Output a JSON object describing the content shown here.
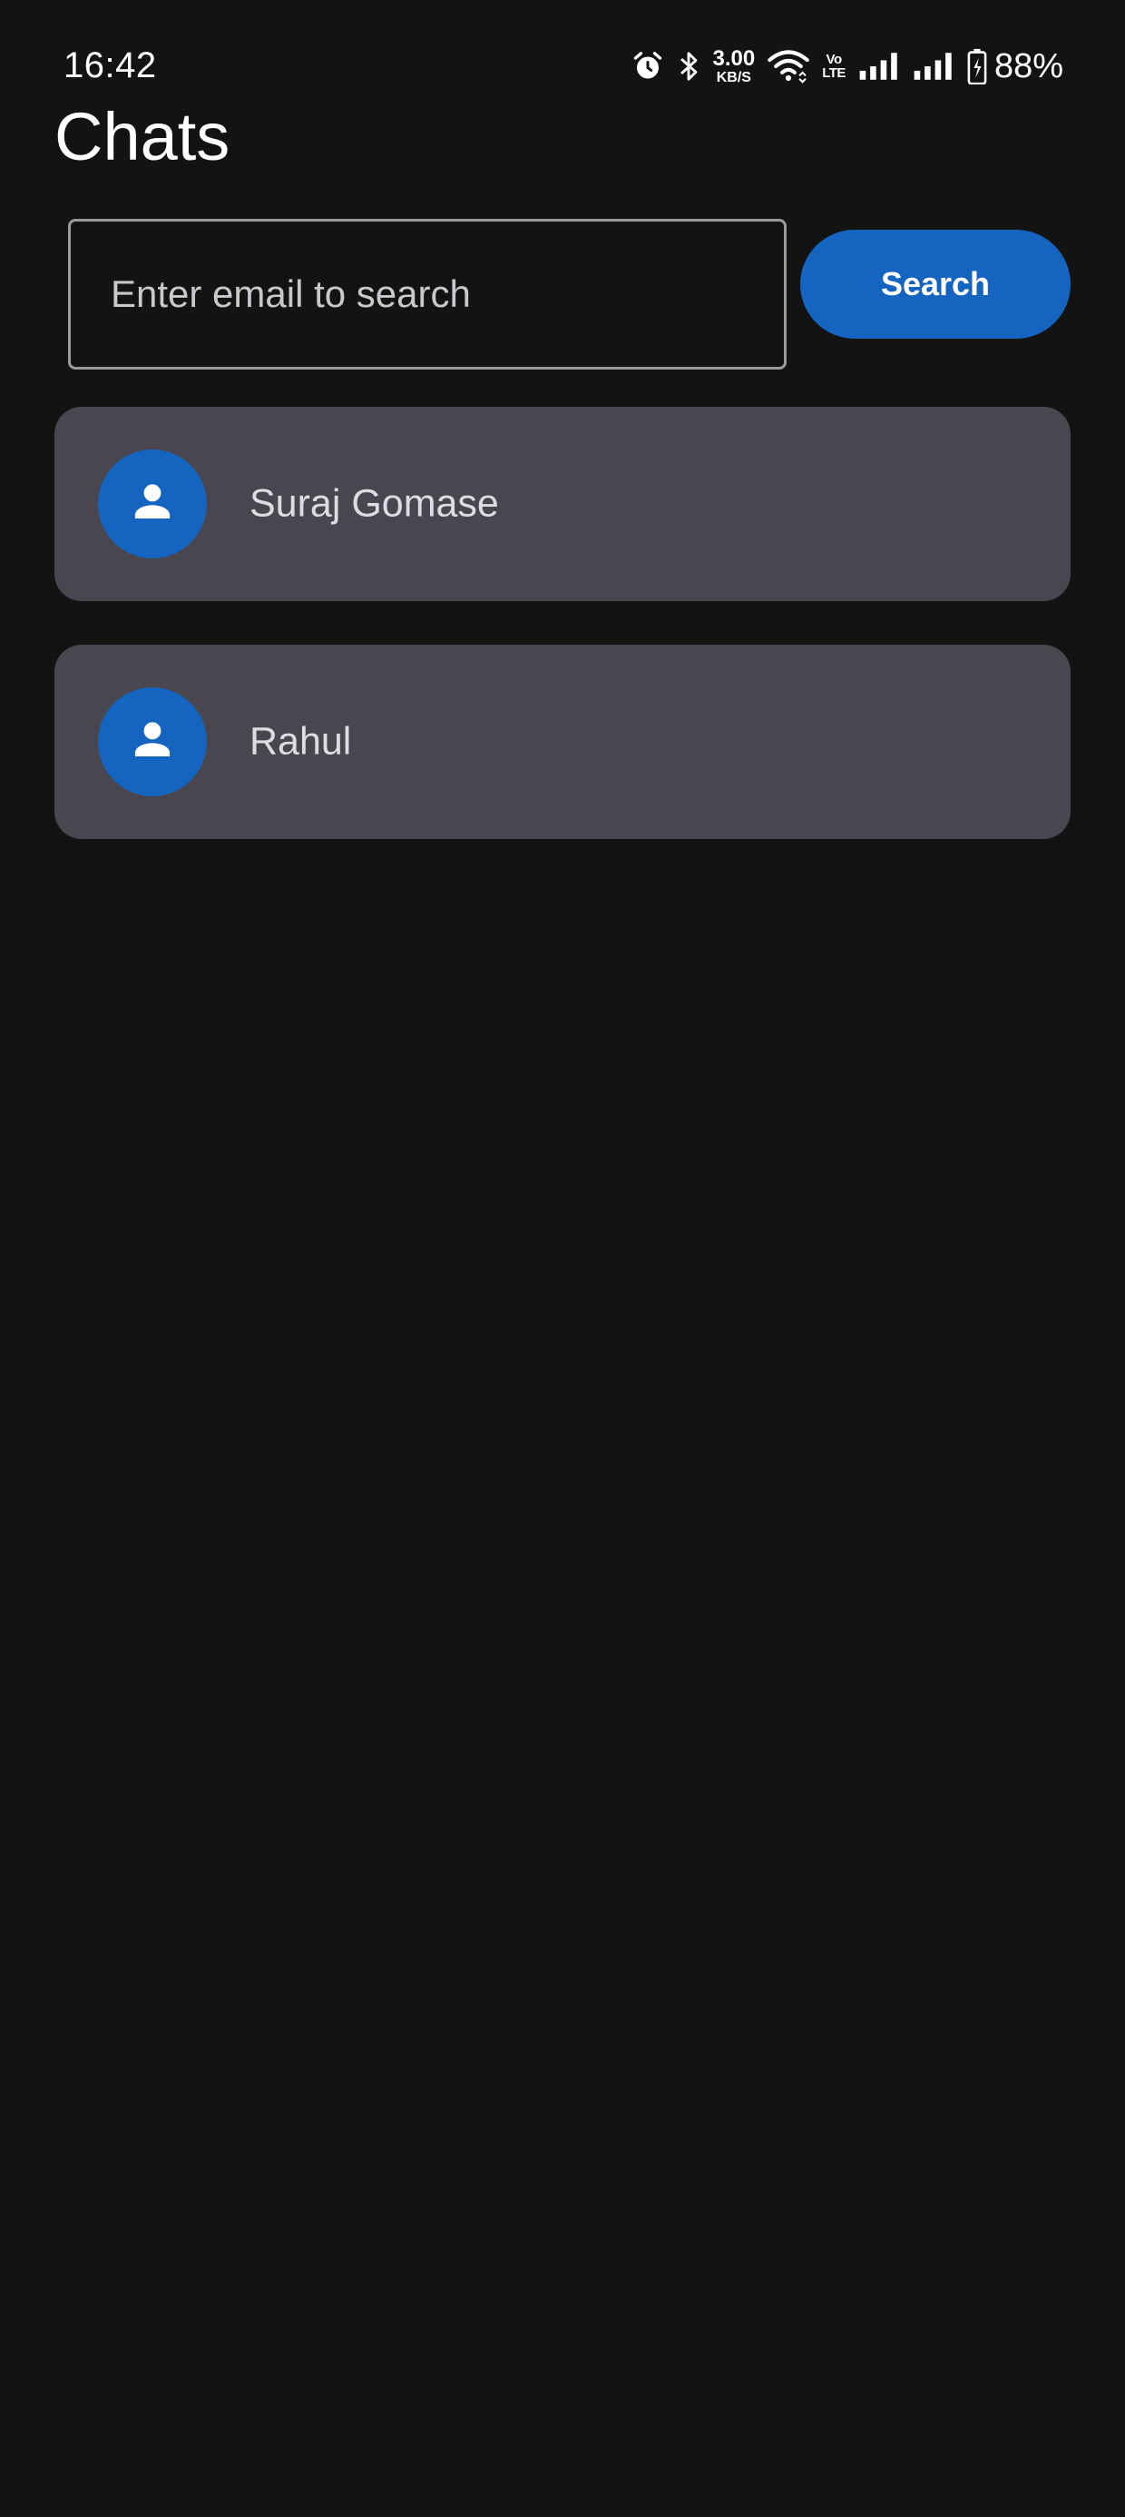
{
  "status_bar": {
    "time": "16:42",
    "net_speed_value": "3.00",
    "net_speed_unit": "KB/S",
    "volte_top": "Vo",
    "volte_bottom": "LTE",
    "battery_percent": "88%",
    "icons": [
      "alarm-icon",
      "bluetooth-icon",
      "wifi-icon",
      "volte-icon",
      "signal-icon",
      "signal-icon",
      "battery-charging-icon"
    ]
  },
  "header": {
    "title": "Chats"
  },
  "search": {
    "placeholder": "Enter email to search",
    "value": "",
    "button_label": "Search"
  },
  "chats": [
    {
      "name": "Suraj Gomase",
      "avatar_icon": "person-icon"
    },
    {
      "name": "Rahul",
      "avatar_icon": "person-icon"
    }
  ],
  "colors": {
    "background": "#131314",
    "accent": "#1565c0",
    "card": "#49464f",
    "text": "#ffffff"
  }
}
